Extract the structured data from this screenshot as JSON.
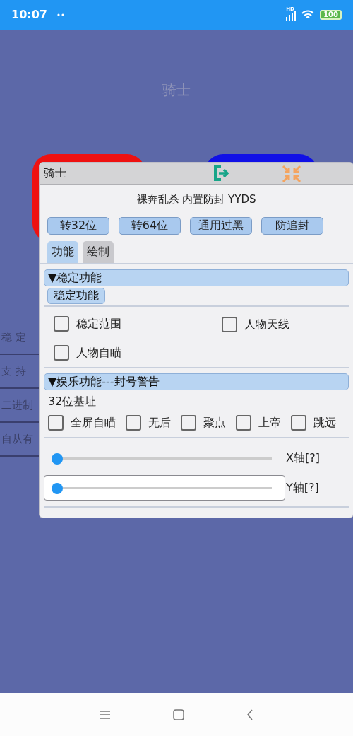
{
  "status_bar": {
    "time": "10:07",
    "network": "HD",
    "battery": "100"
  },
  "app_title": "骑士",
  "side_list": [
    {
      "label": "稳 定"
    },
    {
      "label": "支 持"
    },
    {
      "label": "二进制"
    },
    {
      "label": "自从有"
    }
  ],
  "window": {
    "title": "骑士",
    "subtitle": "裸奔乱杀 内置防封 YYDS",
    "buttons": [
      "转32位",
      "转64位",
      "通用过黑",
      "防追封"
    ],
    "tabs": [
      {
        "label": "功能",
        "selected": true
      },
      {
        "label": "绘制",
        "selected": false
      }
    ],
    "sections": [
      {
        "header": "▼稳定功能",
        "button": "稳定功能",
        "kind": "grid",
        "checkboxes": [
          {
            "label": "稳定范围",
            "checked": false
          },
          {
            "label": "人物天线",
            "checked": false
          },
          {
            "label": "人物自瞄",
            "checked": false
          }
        ]
      },
      {
        "header": "▼娱乐功能---封号警告",
        "note": "32位基址",
        "kind": "row",
        "checkboxes": [
          {
            "label": "全屏自瞄",
            "checked": false
          },
          {
            "label": "无后",
            "checked": false
          },
          {
            "label": "聚点",
            "checked": false
          },
          {
            "label": "上帝",
            "checked": false
          },
          {
            "label": "跳远",
            "checked": false
          }
        ],
        "sliders": [
          {
            "label": "X轴[?]",
            "level": 0,
            "focused": false
          },
          {
            "label": "Y轴[?]",
            "level": 0,
            "focused": true
          }
        ]
      }
    ]
  }
}
